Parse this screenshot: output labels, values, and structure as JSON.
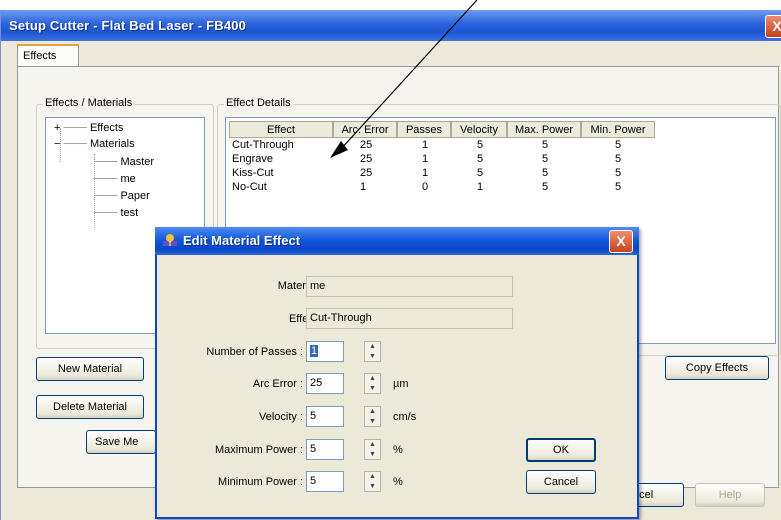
{
  "window": {
    "title": "Setup Cutter - Flat Bed Laser - FB400",
    "close_glyph": "X",
    "tab": "Effects"
  },
  "effects_materials": {
    "group_label": "Effects / Materials",
    "tree": [
      {
        "label": "Effects",
        "expander": "+"
      },
      {
        "label": "Materials",
        "expander": "−"
      },
      {
        "label": "Master"
      },
      {
        "label": "me"
      },
      {
        "label": "Paper"
      },
      {
        "label": "test"
      }
    ]
  },
  "effect_details": {
    "group_label": "Effect Details",
    "columns": [
      "Effect",
      "Arc. Error",
      "Passes",
      "Velocity",
      "Max. Power",
      "Min. Power"
    ],
    "rows": [
      [
        "Cut-Through",
        "25",
        "1",
        "5",
        "5",
        "5"
      ],
      [
        "Engrave",
        "25",
        "1",
        "5",
        "5",
        "5"
      ],
      [
        "Kiss-Cut",
        "25",
        "1",
        "5",
        "5",
        "5"
      ],
      [
        "No-Cut",
        "1",
        "0",
        "1",
        "5",
        "5"
      ]
    ]
  },
  "buttons": {
    "new_material": "New Material",
    "delete_material": "Delete Material",
    "save_material": "Save Me",
    "copy_effects": "Copy Effects",
    "cancel_main": "ncel",
    "help": "Help"
  },
  "dialog": {
    "title": "Edit Material Effect",
    "close_glyph": "X",
    "material_label": "Material :",
    "material_value": "me",
    "effect_label": "Effect :",
    "effect_value": "Cut-Through",
    "passes_label": "Number of Passes :",
    "passes_value": "1",
    "arc_label": "Arc Error :",
    "arc_value": "25",
    "arc_unit": "µm",
    "velocity_label": "Velocity :",
    "velocity_value": "5",
    "velocity_unit": "cm/s",
    "maxp_label": "Maximum Power :",
    "maxp_value": "5",
    "maxp_unit": "%",
    "minp_label": "Minimum Power :",
    "minp_value": "5",
    "minp_unit": "%",
    "ok": "OK",
    "cancel": "Cancel"
  },
  "colors": {
    "titlebar": "#2a62dd",
    "dialog_titlebar": "#0d55d9",
    "selection": "#316ac5"
  }
}
